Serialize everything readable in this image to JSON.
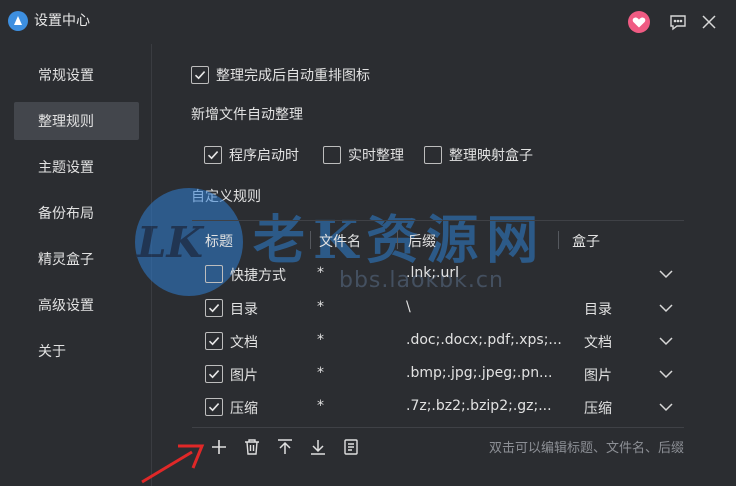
{
  "window": {
    "title": "设置中心",
    "buttons": [
      "heart-icon",
      "feedback-icon",
      "close-icon"
    ]
  },
  "sidebar": {
    "items": [
      {
        "label": "常规设置",
        "active": false
      },
      {
        "label": "整理规则",
        "active": true
      },
      {
        "label": "主题设置",
        "active": false
      },
      {
        "label": "备份布局",
        "active": false
      },
      {
        "label": "精灵盒子",
        "active": false
      },
      {
        "label": "高级设置",
        "active": false
      },
      {
        "label": "关于",
        "active": false
      }
    ]
  },
  "main": {
    "auto_rearrange": {
      "label": "整理完成后自动重排图标",
      "checked": true
    },
    "new_files_title": "新增文件自动整理",
    "new_files_options": [
      {
        "label": "程序启动时",
        "checked": true
      },
      {
        "label": "实时整理",
        "checked": false
      },
      {
        "label": "整理映射盒子",
        "checked": false
      }
    ],
    "custom_rules_title": "自定义规则",
    "table": {
      "headers": [
        "标题",
        "文件名",
        "后缀",
        "盒子"
      ],
      "rows": [
        {
          "checked": false,
          "title": "快捷方式",
          "filename": "*",
          "suffix": ".lnk;.url",
          "box": ""
        },
        {
          "checked": true,
          "title": "目录",
          "filename": "*",
          "suffix": "\\",
          "box": "目录"
        },
        {
          "checked": true,
          "title": "文档",
          "filename": "*",
          "suffix": ".doc;.docx;.pdf;.xps;...",
          "box": "文档"
        },
        {
          "checked": true,
          "title": "图片",
          "filename": "*",
          "suffix": ".bmp;.jpg;.jpeg;.pn...",
          "box": "图片"
        },
        {
          "checked": true,
          "title": "压缩",
          "filename": "*",
          "suffix": ".7z;.bz2;.bzip2;.gz;...",
          "box": "压缩"
        }
      ]
    },
    "toolbar": [
      "add-icon",
      "delete-icon",
      "move-top-icon",
      "move-bottom-icon",
      "notes-icon"
    ],
    "hint": "双击可以编辑标题、文件名、后缀"
  },
  "watermark": {
    "text": "老K资源网",
    "url": "bbs.laokbk.cn",
    "logo": "LK"
  },
  "colors": {
    "background": "#2b2d31",
    "active_nav": "#43464c",
    "heart": "#f05b83",
    "watermark_blue": "#2d7fd0",
    "arrow_red": "#e02828"
  }
}
